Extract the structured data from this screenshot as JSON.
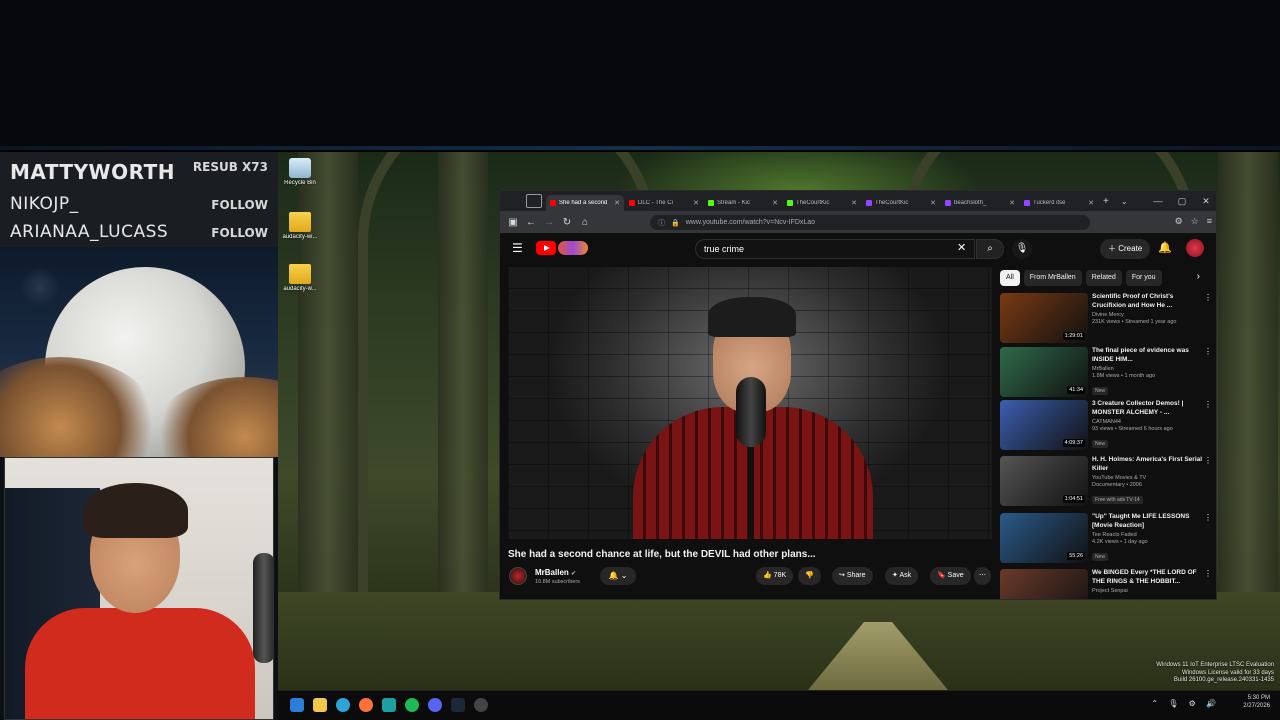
{
  "overlay": {
    "rows": [
      {
        "name": "MATTYWORTH",
        "action": "RESUB X73"
      },
      {
        "name": "NIKOJP_",
        "action": "FOLLOW"
      },
      {
        "name": "ARIANAA_LUCASS",
        "action": "FOLLOW"
      }
    ]
  },
  "desktop": {
    "icons": [
      {
        "label": "Recycle Bin",
        "type": "bin"
      },
      {
        "label": "audacity-wi...",
        "type": "folder"
      },
      {
        "label": "audacity-w...",
        "type": "folder"
      }
    ],
    "watermark": {
      "line1": "Windows 11 IoT Enterprise LTSC Evaluation",
      "line2": "Windows License valid for 33 days",
      "line3": "Build 26100.ge_release.240331-1435"
    }
  },
  "browser": {
    "tabs": [
      {
        "title": "She had a second",
        "color": "#ff0000",
        "active": true
      },
      {
        "title": "DLC - The Ci",
        "color": "#ff0000",
        "active": false
      },
      {
        "title": "Stream - Kic",
        "color": "#53fc18",
        "active": false
      },
      {
        "title": "TheCourtKic",
        "color": "#53fc18",
        "active": false
      },
      {
        "title": "TheCourtKic",
        "color": "#9146ff",
        "active": false
      },
      {
        "title": "beachsloth_",
        "color": "#9146ff",
        "active": false
      },
      {
        "title": "Tuckerd itse",
        "color": "#9146ff",
        "active": false
      }
    ],
    "url": "www.youtube.com/watch?v=Ncv-IFDxLao",
    "window_controls": [
      "—",
      "▢",
      "✕"
    ]
  },
  "youtube": {
    "search_value": "true crime",
    "create_label": "Create",
    "video": {
      "title": "She had a second chance at life, but the DEVIL had other plans...",
      "channel": "MrBallen",
      "subscribers": "10.8M subscribers",
      "likes": "78K",
      "share_label": "Share",
      "ask_label": "Ask",
      "save_label": "Save"
    },
    "chips": [
      {
        "label": "All",
        "selected": true
      },
      {
        "label": "From MrBallen",
        "selected": false
      },
      {
        "label": "Related",
        "selected": false
      },
      {
        "label": "For you",
        "selected": false
      }
    ],
    "recommendations": [
      {
        "title": "Scientific Proof of Christ's Crucifixion and How He ...",
        "channel": "Divine Mercy",
        "meta": "231K views • Streamed 1 year ago",
        "duration": "1:29:01",
        "badge": "",
        "thumb": "#7a3a12"
      },
      {
        "title": "The final piece of evidence was INSIDE HIM...",
        "channel": "MrBallen",
        "meta": "1.8M views • 1 month ago",
        "duration": "41:34",
        "badge": "New",
        "thumb": "#2f6a4a"
      },
      {
        "title": "3 Creature Collector Demos! | MONSTER ALCHEMY - ...",
        "channel": "CATMAN44",
        "meta": "93 views • Streamed 6 hours ago",
        "duration": "4:09:37",
        "badge": "New",
        "thumb": "#3b5fb0"
      },
      {
        "title": "H. H. Holmes: America's First Serial Killer",
        "channel": "YouTube Movies & TV",
        "meta": "Documentary • 2006",
        "duration": "1:04:51",
        "badge": "Free with ads  TV-14",
        "thumb": "#555555"
      },
      {
        "title": "\"Up\" Taught Me LIFE LESSONS [Movie Reaction]",
        "channel": "Tee Reacts Faded",
        "meta": "4.2K views • 1 day ago",
        "duration": "55:26",
        "badge": "New",
        "thumb": "#2a5a8a"
      },
      {
        "title": "We BINGED Every *THE LORD OF THE RINGS & THE HOBBIT...",
        "channel": "Project Senpai",
        "meta": "",
        "duration": "",
        "badge": "",
        "thumb": "#6a3a2a"
      }
    ]
  },
  "taskbar": {
    "time": "5:30 PM",
    "date": "2/27/2026"
  }
}
